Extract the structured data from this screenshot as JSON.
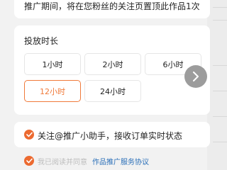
{
  "notice": {
    "text": "推广期间，将在您粉丝的关注页置顶此作品1次"
  },
  "duration": {
    "title": "投放时长",
    "options": [
      {
        "label": "1小时",
        "selected": false
      },
      {
        "label": "2小时",
        "selected": false
      },
      {
        "label": "6小时",
        "selected": false
      },
      {
        "label": "12小时",
        "selected": true
      },
      {
        "label": "24小时",
        "selected": false
      }
    ],
    "scroll_icon": "chevron-right-icon"
  },
  "follow": {
    "text": "关注@推广小助手，接收订单实时状态",
    "checked": true
  },
  "agreement": {
    "prefix": "我已阅读并同意",
    "link": "作品推广服务协议",
    "checked": true
  },
  "colors": {
    "accent": "#ec6a30",
    "selected_border": "#f07a3a",
    "link": "#2a6fb8",
    "background": "#f2f2f2"
  }
}
